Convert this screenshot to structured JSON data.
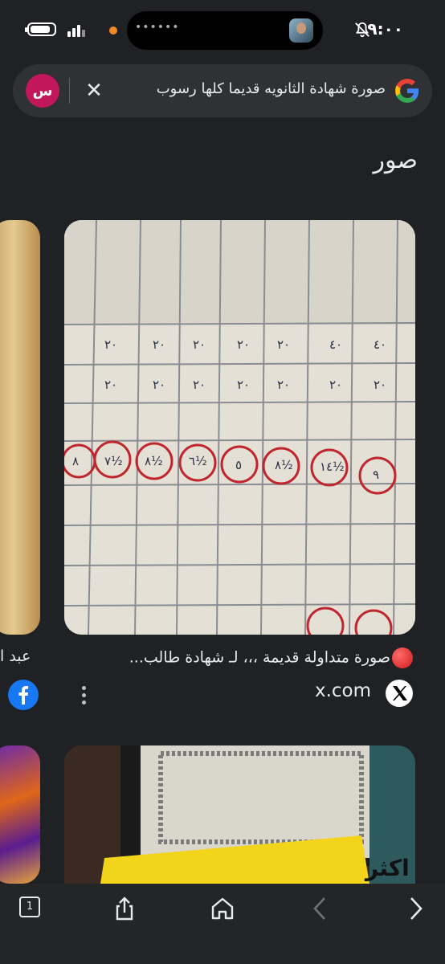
{
  "status": {
    "time": "٩:٠٠",
    "island_dots": "••••••"
  },
  "search": {
    "query": "صورة شهادة الثانويه قديما كلها رسوب",
    "avatar_letter": "س"
  },
  "section": {
    "title": "صور"
  },
  "results": [
    {
      "caption": "صورة متداولة قديمة ،،، لـ شهادة طالب...",
      "source": "x.com"
    }
  ],
  "left_result": {
    "caption": "عبد ا"
  },
  "second_card": {
    "banner_text": "قيمتها اكثر"
  },
  "bottom_bar": {
    "tabs_count": "1"
  },
  "colors": {
    "background": "#202124",
    "search_bg": "#303134",
    "avatar": "#c2185b",
    "facebook": "#1877f2"
  }
}
